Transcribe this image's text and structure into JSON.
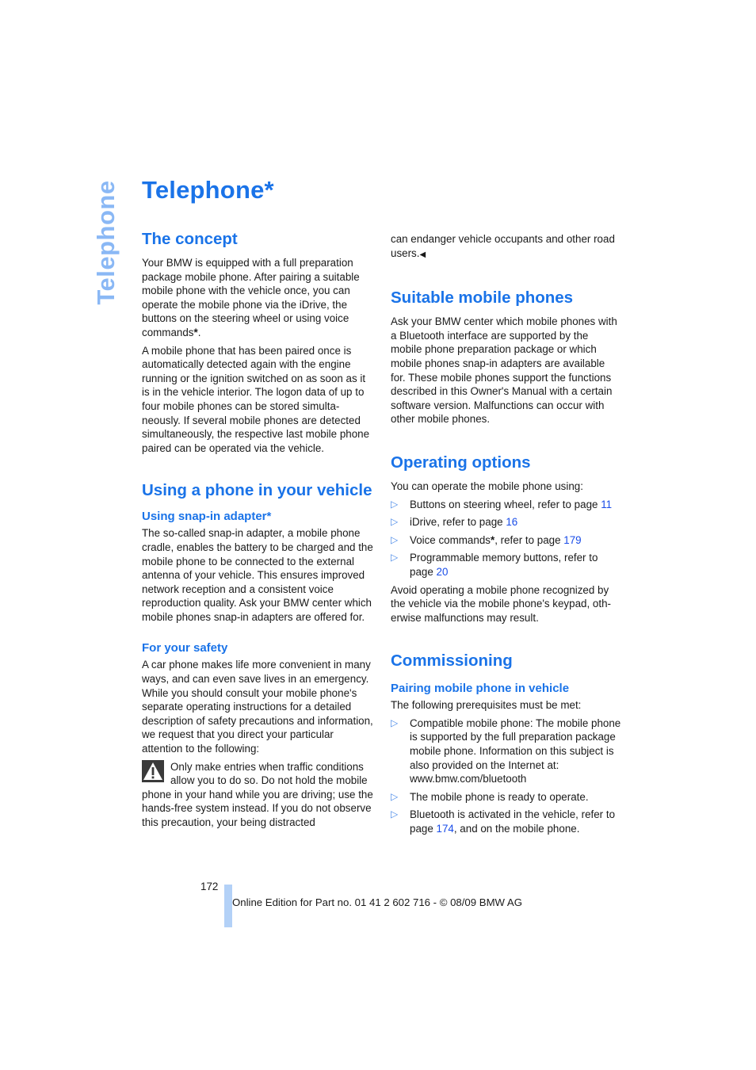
{
  "side_tab": "Telephone",
  "title": "Telephone*",
  "left": {
    "concept": {
      "heading": "The concept",
      "p1_text": "Your BMW is equipped with a full preparation package mobile phone. After pairing a suitable mobile phone with the vehicle once, you can operate the mobile phone via the iDrive, the buttons on the steering wheel or using voice commands",
      "p1_star": "*",
      "p1_end": ".",
      "p2": "A mobile phone that has been paired once is automatically detected again with the engine running or the ignition switched on as soon as it is in the vehicle interior. The logon data of up to four mobile phones can be stored simulta­neously. If several mobile phones are detected simultaneously, the respective last mobile phone paired can be operated via the vehicle."
    },
    "using": {
      "heading": "Using a phone in your vehicle",
      "snapin_heading": "Using snap-in adapter*",
      "snapin_text": "The so-called snap-in adapter, a mobile phone cradle, enables the battery to be charged and the mobile phone to be connected to the exter­nal antenna of your vehicle. This ensures improved network reception and a consistent voice reproduction quality. Ask your BMW cen­ter which mobile phones snap-in adapters are offered for.",
      "safety_heading": "For your safety",
      "safety_text": "A car phone makes life more convenient in many ways, and can even save lives in an emer­gency. While you should consult your mobile phone's separate operating instructions for a detailed description of safety precautions and information, we request that you direct your particular attention to the following:",
      "warning_text": "Only make entries when traffic conditions allow you to do so. Do not hold the mobile phone in your hand while you are driving; use the hands-free system instead. If you do not observe this precaution, your being distracted"
    }
  },
  "right": {
    "warning_cont": "can endanger vehicle occupants and other road users.",
    "end_mark": "◀",
    "suitable": {
      "heading": "Suitable mobile phones",
      "text": "Ask your BMW center which mobile phones with a Bluetooth interface are supported by the mobile phone preparation package or which mobile phones snap-in adapters are available for. These mobile phones support the functions described in this Owner's Manual with a certain software version. Malfunctions can occur with other mobile phones."
    },
    "operating": {
      "heading": "Operating options",
      "intro": "You can operate the mobile phone using:",
      "items": [
        {
          "text": "Buttons on steering wheel, refer to page ",
          "star": "",
          "after": "",
          "page": "11"
        },
        {
          "text": "iDrive, refer to page ",
          "star": "",
          "after": "",
          "page": "16"
        },
        {
          "text": "Voice commands",
          "star": "*",
          "after": ", refer to page ",
          "page": "179"
        },
        {
          "text": "Programmable memory buttons, refer to page ",
          "star": "",
          "after": "",
          "page": "20"
        }
      ],
      "note": "Avoid operating a mobile phone recognized by the vehicle via the mobile phone's keypad, oth­erwise malfunctions may result."
    },
    "commissioning": {
      "heading": "Commissioning",
      "sub_heading": "Pairing mobile phone in vehicle",
      "intro": "The following prerequisites must be met:",
      "items": [
        {
          "text": "Compatible mobile phone: The mobile phone is supported by the full preparation package mobile phone. Information on this subject is also provided on the Internet at: www.bmw.com/bluetooth",
          "page": "",
          "after": ""
        },
        {
          "text": "The mobile phone is ready to operate.",
          "page": "",
          "after": ""
        },
        {
          "text": "Bluetooth is activated in the vehicle, refer to page ",
          "page": "174",
          "after": ", and on the mobile phone."
        }
      ]
    }
  },
  "bullet_glyph": "▷",
  "footer": {
    "page_number": "172",
    "edition": "Online Edition for Part no. 01 41 2 602 716 - © 08/09 BMW AG"
  }
}
